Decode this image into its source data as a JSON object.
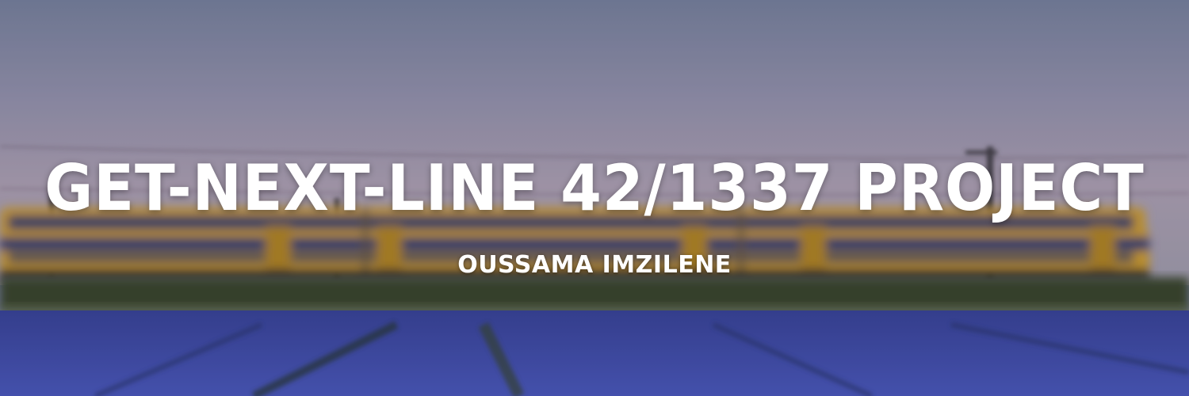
{
  "banner": {
    "title": "GET-NEXT-LINE 42/1337 PROJECT",
    "author": "OUSSAMA IMZILENE"
  },
  "colors": {
    "sky_top": "#7f88a8",
    "sky_mid": "#a39fb8",
    "sky_horizon": "#b7a9bd",
    "train_yellow": "#d5a534",
    "train_blue": "#1f3c78",
    "grass": "#3f4b33",
    "flowers": "#4a56b8",
    "text": "#ffffff"
  },
  "icons": [
    "train-graphic",
    "catenary-pole-icon"
  ]
}
